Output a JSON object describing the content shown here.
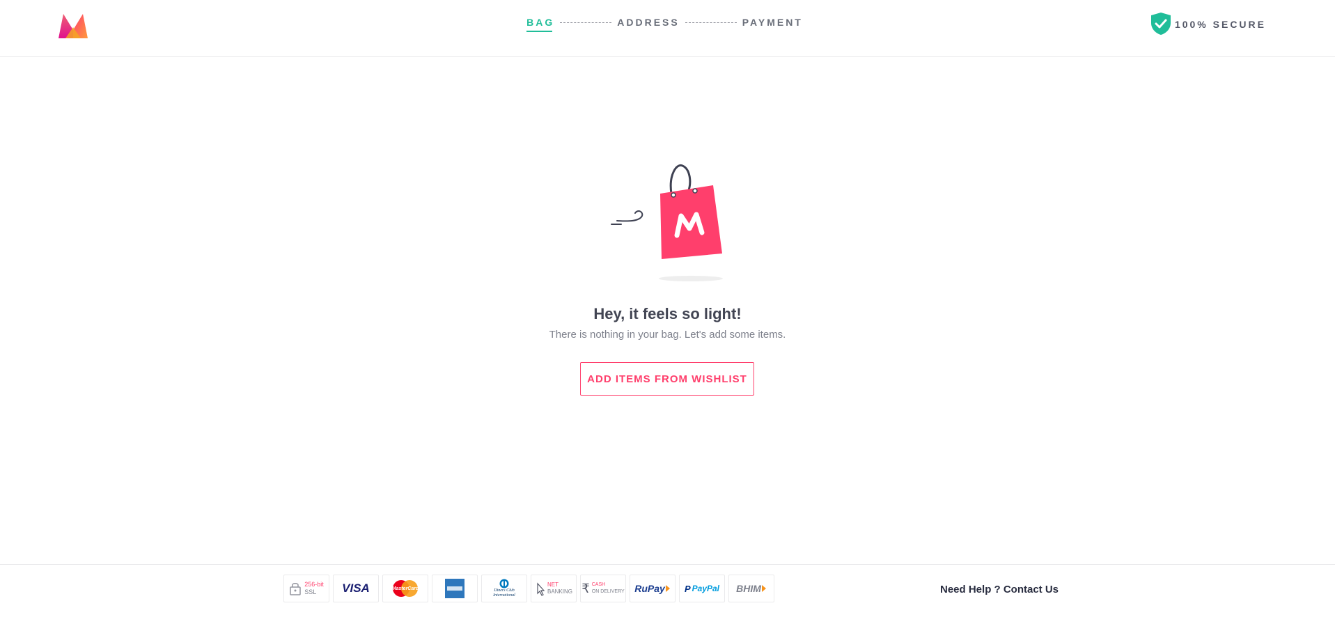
{
  "header": {
    "logo_icon": "myntra-logo-icon",
    "steps": [
      {
        "label": "BAG",
        "active": true
      },
      {
        "label": "ADDRESS",
        "active": false
      },
      {
        "label": "PAYMENT",
        "active": false
      }
    ],
    "secure_icon": "shield-check-icon",
    "secure_label": "100% SECURE"
  },
  "empty_bag": {
    "illustration_icon": "shopping-bag-icon",
    "title": "Hey, it feels so light!",
    "subtitle": "There is nothing in your bag. Let's add some items.",
    "button_label": "ADD ITEMS FROM WISHLIST"
  },
  "footer": {
    "payment_methods": [
      {
        "name": "ssl-icon",
        "line1": "256-bit",
        "line2": "SSL"
      },
      {
        "name": "visa-icon",
        "text": "VISA"
      },
      {
        "name": "mastercard-icon",
        "text": "MasterCard"
      },
      {
        "name": "amex-icon",
        "text": ""
      },
      {
        "name": "diners-club-icon",
        "line1": "Diners Club",
        "line2": "International"
      },
      {
        "name": "net-banking-icon",
        "line1": "NET",
        "line2": "BANKING"
      },
      {
        "name": "cash-on-delivery-icon",
        "line1": "CASH",
        "line2": "ON DELIVERY"
      },
      {
        "name": "rupay-icon",
        "text": "RuPay"
      },
      {
        "name": "paypal-icon",
        "text": "PayPal"
      },
      {
        "name": "bhim-icon",
        "text": "BHIM"
      }
    ],
    "help_text": "Need Help ? Contact Us"
  },
  "colors": {
    "accent": "#ff3f6c",
    "active_step": "#20bd99",
    "secure_green": "#20bd99"
  }
}
